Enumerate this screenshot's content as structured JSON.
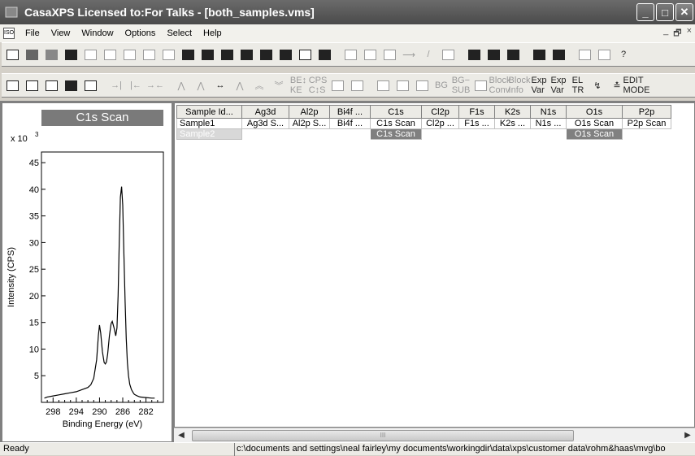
{
  "window": {
    "title": "CasaXPS Licensed to:For Talks - [both_samples.vms]",
    "controls": [
      "_",
      "□",
      "✕"
    ]
  },
  "menu": {
    "doc_icon_text": "ISO",
    "items": [
      "File",
      "View",
      "Window",
      "Options",
      "Select",
      "Help"
    ],
    "mdi_controls": [
      "_",
      "🗗",
      "×"
    ]
  },
  "toolbar2": {
    "labels": {
      "be_ke": "BE↕\nKE",
      "cps_cs": "CPS\nC↕S",
      "bg": "BG",
      "bg_sub": "BG−\nSUB",
      "block_conv": "Block\nConv",
      "block_info": "Block\nInfo",
      "exp_var1": "Exp\nVar",
      "exp_var2": "Exp\nVar",
      "el_tr": "EL\nTR",
      "edit_mode": "EDIT\nMODE"
    }
  },
  "spectrum": {
    "title": "C1s Scan",
    "ylabel": "Intensity (CPS)",
    "xlabel": "Binding Energy (eV)",
    "multiplier": "x 10",
    "multiplier_exp": "3"
  },
  "chart_data": {
    "type": "line",
    "title": "C1s Scan",
    "xlabel": "Binding Energy (eV)",
    "ylabel": "Intensity (CPS)",
    "y_multiplier": "x 10^3",
    "x_reversed": true,
    "xlim": [
      300,
      279
    ],
    "ylim": [
      0,
      47
    ],
    "x_ticks": [
      "298",
      "294",
      "290",
      "286",
      "282"
    ],
    "y_ticks": [
      "5",
      "10",
      "15",
      "20",
      "25",
      "30",
      "35",
      "40",
      "45"
    ],
    "series": [
      {
        "x": [
          299.5,
          299,
          298,
          297,
          296,
          295,
          294,
          293,
          292,
          291.5,
          291,
          290.5,
          290.2,
          290,
          289.8,
          289.5,
          289.2,
          289,
          288.8,
          288.6,
          288.3,
          288,
          287.8,
          287.5,
          287.2,
          287,
          286.8,
          286.6,
          286.4,
          286.2,
          286,
          285.8,
          285.6,
          285.4,
          285.2,
          285,
          284.8,
          284.5,
          284.2,
          284,
          283.5,
          283,
          282,
          281,
          280.5
        ],
        "y": [
          0.8,
          1.0,
          1.2,
          1.4,
          1.6,
          1.8,
          2.0,
          2.4,
          2.8,
          3.3,
          4.5,
          8.0,
          12.5,
          14.5,
          13.0,
          9.5,
          7.5,
          7.2,
          7.6,
          9.0,
          12.5,
          14.8,
          15.2,
          14.0,
          12.5,
          14.0,
          20.0,
          30.0,
          38.5,
          40.5,
          37.0,
          28.0,
          19.0,
          12.0,
          7.5,
          5.0,
          3.4,
          2.4,
          1.8,
          1.5,
          1.2,
          1.0,
          0.9,
          0.8,
          0.8
        ]
      }
    ]
  },
  "grid": {
    "columns": [
      "Sample Id...",
      "Ag3d",
      "Al2p",
      "Bi4f ...",
      "C1s",
      "Cl2p",
      "F1s",
      "K2s",
      "N1s",
      "O1s",
      "P2p"
    ],
    "rows": [
      [
        "Sample1",
        "Ag3d S...",
        "Al2p S...",
        "Bi4f ...",
        "C1s Scan",
        "Cl2p ...",
        "F1s ...",
        "K2s ...",
        "N1s ...",
        "O1s Scan",
        "P2p Scan"
      ],
      [
        "Sample2",
        "",
        "",
        "",
        "C1s Scan",
        "",
        "",
        "",
        "",
        "O1s Scan",
        ""
      ]
    ]
  },
  "status": {
    "ready": "Ready",
    "path": "c:\\documents and settings\\neal fairley\\my documents\\workingdir\\data\\xps\\customer data\\rohm&haas\\mvg\\bo"
  },
  "scroll": {
    "grip": "III"
  }
}
